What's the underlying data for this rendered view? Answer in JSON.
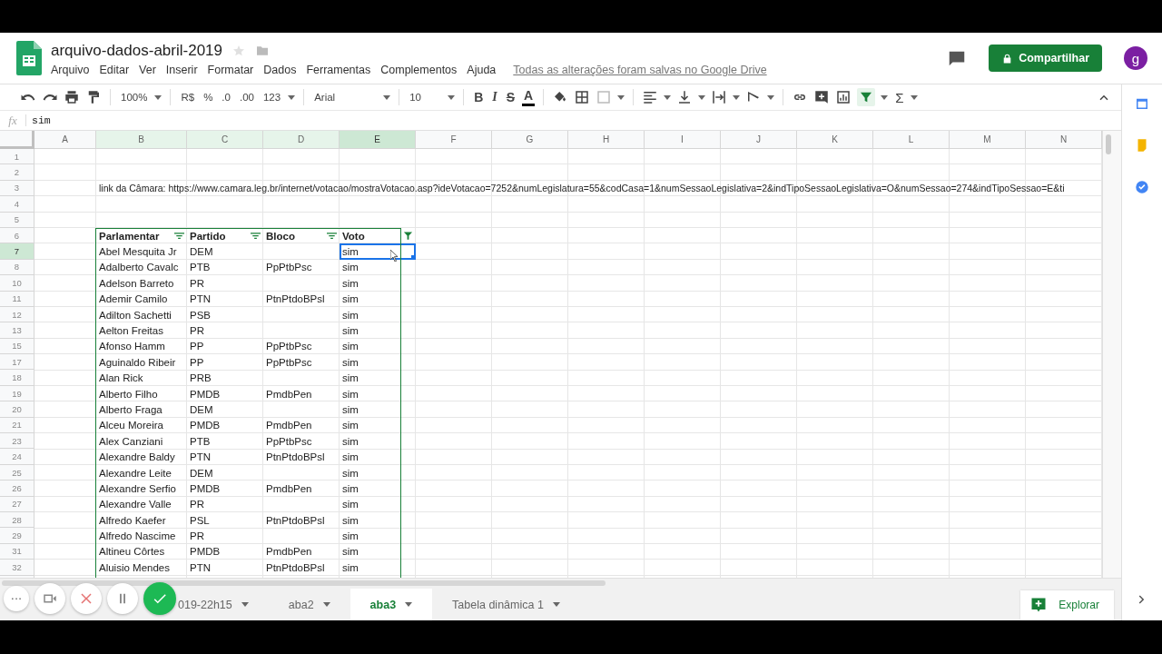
{
  "document": {
    "title": "arquivo-dados-abril-2019",
    "starred": false
  },
  "menu": [
    "Arquivo",
    "Editar",
    "Ver",
    "Inserir",
    "Formatar",
    "Dados",
    "Ferramentas",
    "Complementos",
    "Ajuda"
  ],
  "save_status": "Todas as alterações foram salvas no Google Drive",
  "share_button": "Compartilhar",
  "avatar": "g",
  "toolbar": {
    "zoom": "100%",
    "currency": "R$",
    "percent": "%",
    "decimal_less": ".0",
    "decimal_more": ".00",
    "number_format": "123",
    "font": "Arial",
    "font_size": "10",
    "bold": "B",
    "italic": "I",
    "strike": "S",
    "text_color": "A",
    "functions": "Σ",
    "filter_on": true
  },
  "formula_bar": {
    "label": "fx",
    "value": "sim"
  },
  "columns": [
    {
      "label": "A",
      "selected": false,
      "in_range": false
    },
    {
      "label": "B",
      "selected": false,
      "in_range": true
    },
    {
      "label": "C",
      "selected": false,
      "in_range": true
    },
    {
      "label": "D",
      "selected": false,
      "in_range": true
    },
    {
      "label": "E",
      "selected": true,
      "in_range": true
    },
    {
      "label": "F",
      "selected": false,
      "in_range": false
    },
    {
      "label": "G",
      "selected": false,
      "in_range": false
    },
    {
      "label": "H",
      "selected": false,
      "in_range": false
    },
    {
      "label": "I",
      "selected": false,
      "in_range": false
    },
    {
      "label": "J",
      "selected": false,
      "in_range": false
    },
    {
      "label": "K",
      "selected": false,
      "in_range": false
    },
    {
      "label": "L",
      "selected": false,
      "in_range": false
    },
    {
      "label": "M",
      "selected": false,
      "in_range": false
    },
    {
      "label": "N",
      "selected": false,
      "in_range": false
    }
  ],
  "rows": [
    {
      "number": "1",
      "kind": "blank",
      "selected": false
    },
    {
      "number": "2",
      "kind": "blank",
      "selected": false
    },
    {
      "number": "3",
      "kind": "note",
      "selected": false,
      "text": "link da Câmara: https://www.camara.leg.br/internet/votacao/mostraVotacao.asp?ideVotacao=7252&numLegislatura=55&codCasa=1&numSessaoLegislativa=2&indTipoSessaoLegislativa=O&numSessao=274&indTipoSessao=E&ti"
    },
    {
      "number": "4",
      "kind": "blank",
      "selected": false
    },
    {
      "number": "5",
      "kind": "blank",
      "selected": false
    },
    {
      "number": "6",
      "kind": "header",
      "selected": false,
      "headers": [
        {
          "label": "Parlamentar",
          "filter_active": false
        },
        {
          "label": "Partido",
          "filter_active": false
        },
        {
          "label": "Bloco",
          "filter_active": false
        },
        {
          "label": "Voto",
          "filter_active": true
        }
      ]
    },
    {
      "number": "7",
      "kind": "data",
      "selected": true,
      "parlamentar": "Abel Mesquita Jr",
      "partido": "DEM",
      "voto": "sim"
    },
    {
      "number": "8",
      "kind": "data",
      "selected": false,
      "parlamentar": "Adalberto Cavalc",
      "partido": "PTB",
      "bloco": "PpPtbPsc",
      "voto": "sim"
    },
    {
      "number": "10",
      "kind": "data",
      "selected": false,
      "parlamentar": "Adelson Barreto",
      "partido": "PR",
      "voto": "sim"
    },
    {
      "number": "11",
      "kind": "data",
      "selected": false,
      "parlamentar": "Ademir Camilo",
      "partido": "PTN",
      "bloco": "PtnPtdoBPsl",
      "voto": "sim"
    },
    {
      "number": "12",
      "kind": "data",
      "selected": false,
      "parlamentar": "Adilton Sachetti",
      "partido": "PSB",
      "voto": "sim"
    },
    {
      "number": "13",
      "kind": "data",
      "selected": false,
      "parlamentar": "Aelton Freitas",
      "partido": "PR",
      "voto": "sim"
    },
    {
      "number": "15",
      "kind": "data",
      "selected": false,
      "parlamentar": "Afonso Hamm",
      "partido": "PP",
      "bloco": "PpPtbPsc",
      "voto": "sim"
    },
    {
      "number": "17",
      "kind": "data",
      "selected": false,
      "parlamentar": "Aguinaldo Ribeir",
      "partido": "PP",
      "bloco": "PpPtbPsc",
      "voto": "sim"
    },
    {
      "number": "18",
      "kind": "data",
      "selected": false,
      "parlamentar": "Alan Rick",
      "partido": "PRB",
      "voto": "sim"
    },
    {
      "number": "19",
      "kind": "data",
      "selected": false,
      "parlamentar": "Alberto Filho",
      "partido": "PMDB",
      "bloco": "PmdbPen",
      "voto": "sim"
    },
    {
      "number": "20",
      "kind": "data",
      "selected": false,
      "parlamentar": "Alberto Fraga",
      "partido": "DEM",
      "voto": "sim"
    },
    {
      "number": "21",
      "kind": "data",
      "selected": false,
      "parlamentar": "Alceu Moreira",
      "partido": "PMDB",
      "bloco": "PmdbPen",
      "voto": "sim"
    },
    {
      "number": "23",
      "kind": "data",
      "selected": false,
      "parlamentar": "Alex Canziani",
      "partido": "PTB",
      "bloco": "PpPtbPsc",
      "voto": "sim"
    },
    {
      "number": "24",
      "kind": "data",
      "selected": false,
      "parlamentar": "Alexandre Baldy",
      "partido": "PTN",
      "bloco": "PtnPtdoBPsl",
      "voto": "sim"
    },
    {
      "number": "25",
      "kind": "data",
      "selected": false,
      "parlamentar": "Alexandre Leite",
      "partido": "DEM",
      "voto": "sim"
    },
    {
      "number": "26",
      "kind": "data",
      "selected": false,
      "parlamentar": "Alexandre Serfio",
      "partido": "PMDB",
      "bloco": "PmdbPen",
      "voto": "sim"
    },
    {
      "number": "27",
      "kind": "data",
      "selected": false,
      "parlamentar": "Alexandre Valle",
      "partido": "PR",
      "voto": "sim"
    },
    {
      "number": "28",
      "kind": "data",
      "selected": false,
      "parlamentar": "Alfredo Kaefer",
      "partido": "PSL",
      "bloco": "PtnPtdoBPsl",
      "voto": "sim"
    },
    {
      "number": "29",
      "kind": "data",
      "selected": false,
      "parlamentar": "Alfredo Nascime",
      "partido": "PR",
      "voto": "sim"
    },
    {
      "number": "31",
      "kind": "data",
      "selected": false,
      "parlamentar": "Altineu Côrtes",
      "partido": "PMDB",
      "bloco": "PmdbPen",
      "voto": "sim"
    },
    {
      "number": "32",
      "kind": "data",
      "selected": false,
      "parlamentar": "Aluisio Mendes",
      "partido": "PTN",
      "bloco": "PtnPtdoBPsl",
      "voto": "sim"
    }
  ],
  "sheet_tabs": [
    {
      "label": "019-22h15",
      "selected": false
    },
    {
      "label": "aba2",
      "selected": false
    },
    {
      "label": "aba3",
      "selected": true
    },
    {
      "label": "Tabela dinâmica 1",
      "selected": false
    }
  ],
  "explore_button": "Explorar",
  "recorder": {
    "more": "···",
    "paused": false
  }
}
